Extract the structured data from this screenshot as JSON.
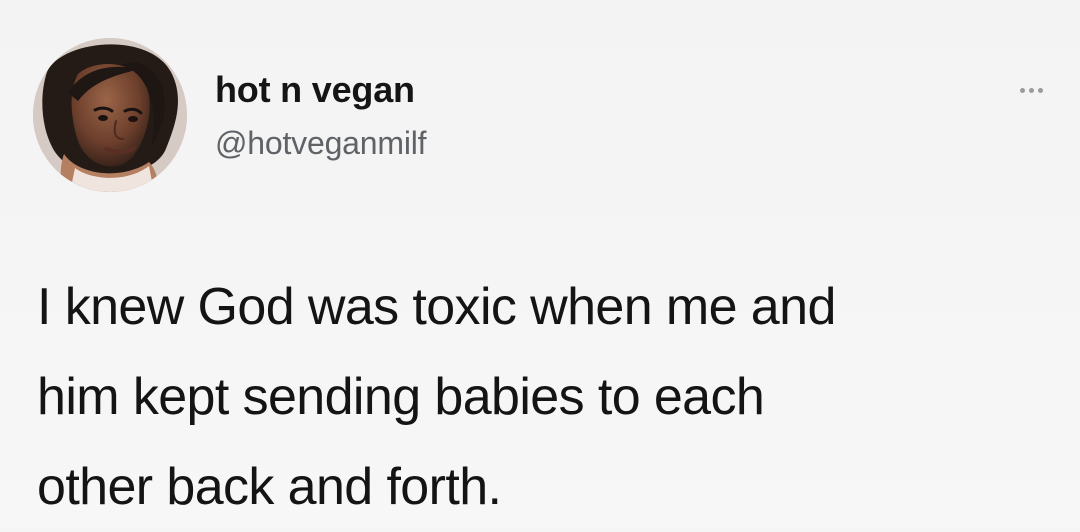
{
  "tweet": {
    "author": {
      "display_name": "hot n vegan",
      "handle": "@hotveganmilf",
      "avatar_icon": "profile-photo"
    },
    "more_icon": "more-horizontal-icon",
    "text_lines": [
      "I knew God was toxic when me and",
      "him kept sending babies to each",
      "other back and forth."
    ]
  },
  "colors": {
    "background": "#f5f5f5",
    "text_primary": "#141414",
    "text_secondary": "#5f6368",
    "icon": "#9b9b9b"
  }
}
